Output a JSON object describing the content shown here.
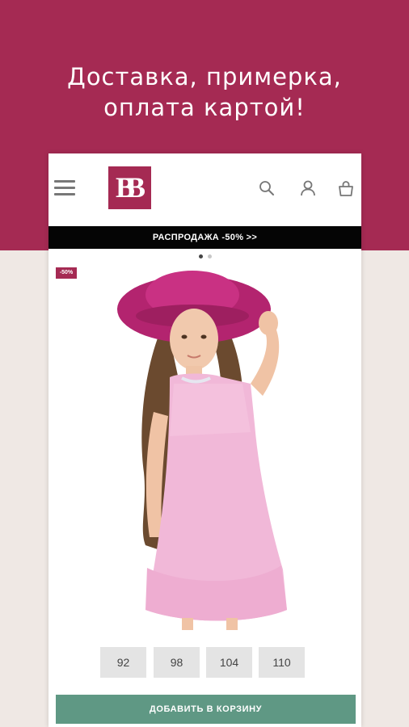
{
  "promo": {
    "line1": "Доставка, примерка,",
    "line2": "оплата картой!",
    "background_color": "#a52a53"
  },
  "header": {
    "menu_icon": "hamburger-menu-icon",
    "logo_text": "BB",
    "icons": [
      "search-icon",
      "user-icon",
      "shopping-bag-icon"
    ]
  },
  "banner": {
    "text": "РАСПРОДАЖА -50% >>"
  },
  "carousel": {
    "slides": 2,
    "active_index": 0
  },
  "product": {
    "discount_badge": "-50%",
    "image_description_icon": "product-photo",
    "sizes": [
      "92",
      "98",
      "104",
      "110"
    ],
    "add_to_cart_label": "ДОБАВИТЬ В КОРЗИНУ",
    "button_color": "#5f9884"
  }
}
